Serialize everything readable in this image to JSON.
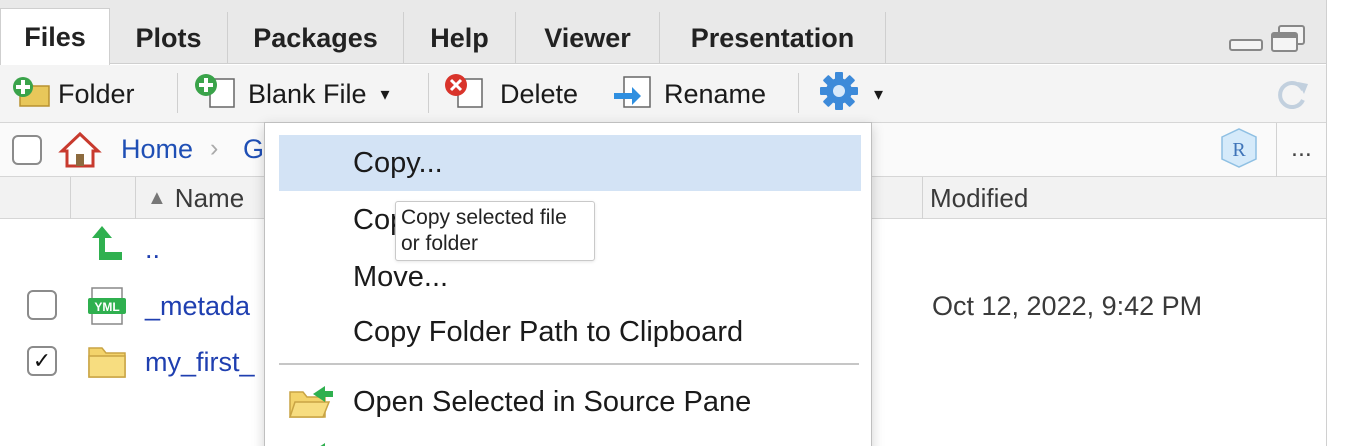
{
  "tabs": [
    "Files",
    "Plots",
    "Packages",
    "Help",
    "Viewer",
    "Presentation"
  ],
  "active_tab": "Files",
  "toolbar": {
    "new_folder": "Folder",
    "blank_file": "Blank File",
    "delete": "Delete",
    "rename": "Rename"
  },
  "breadcrumb": {
    "home": "Home",
    "next": "G",
    "more": "..."
  },
  "columns": {
    "name": "Name",
    "modified": "Modified"
  },
  "files": [
    {
      "name": "..",
      "modified": "",
      "checked": false
    },
    {
      "name": "_metada",
      "modified": "Oct 12, 2022, 9:42 PM",
      "checked": false
    },
    {
      "name": "my_first_",
      "modified": "",
      "checked": true
    }
  ],
  "menu": {
    "items": [
      "Copy...",
      "Cop",
      "Move...",
      "Copy Folder Path to Clipboard",
      "Open Selected in Source Pane"
    ]
  },
  "tooltip": {
    "line1": "Copy selected file",
    "line2": "or folder"
  },
  "colors": {
    "link_blue": "#1f3fb0",
    "menu_highlight": "#d3e3f5",
    "tab_bar": "#e9e9e9"
  }
}
